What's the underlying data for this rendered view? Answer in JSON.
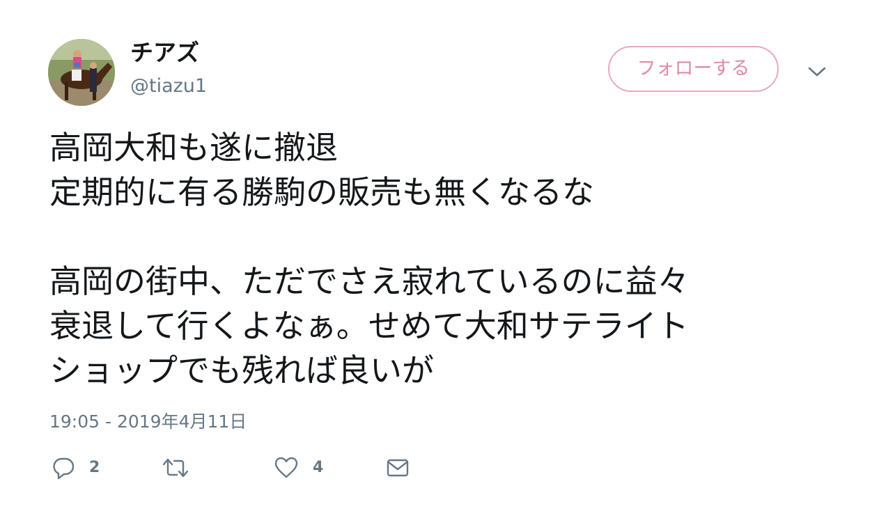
{
  "user": {
    "display_name": "チアズ",
    "handle": "@tiazu1",
    "avatar_icon": "horse-jockey-photo"
  },
  "follow_button": {
    "label": "フォローする",
    "accent_color": "#e08aa5"
  },
  "menu_icon": "chevron-down-icon",
  "tweet": {
    "lines": [
      "高岡大和も遂に撤退",
      "定期的に有る勝駒の販売も無くなるな",
      "",
      "高岡の街中、ただでさえ寂れているのに益々",
      "衰退して行くよなぁ。せめて大和サテライト",
      "ショップでも残れば良いが"
    ],
    "timestamp": "19:05 - 2019年4月11日"
  },
  "actions": {
    "reply": {
      "icon": "reply-icon",
      "count": "2"
    },
    "retweet": {
      "icon": "retweet-icon",
      "count": ""
    },
    "like": {
      "icon": "heart-icon",
      "count": "4"
    },
    "message": {
      "icon": "envelope-icon"
    }
  }
}
